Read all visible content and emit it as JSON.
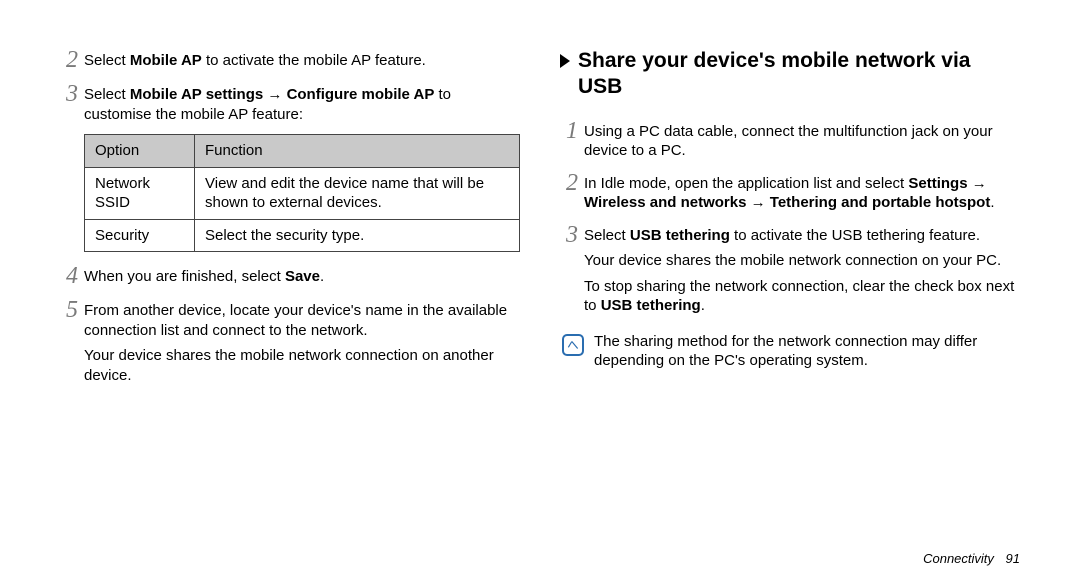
{
  "left": {
    "step2": {
      "num": "2",
      "before": "Select ",
      "b1": "Mobile AP",
      "after": " to activate the mobile AP feature."
    },
    "step3": {
      "num": "3",
      "before": "Select ",
      "b1": "Mobile AP settings",
      "arrow": " → ",
      "b2": "Configure mobile AP",
      "after": " to customise the mobile AP feature:"
    },
    "table": {
      "h1": "Option",
      "h2": "Function",
      "r1c1": "Network SSID",
      "r1c2": "View and edit the device name that will be shown to external devices.",
      "r2c1": "Security",
      "r2c2": "Select the security type."
    },
    "step4": {
      "num": "4",
      "before": "When you are finished, select ",
      "b1": "Save",
      "after": "."
    },
    "step5": {
      "num": "5",
      "p1": "From another device, locate your device's name in the available connection list and connect to the network.",
      "p2": "Your device shares the mobile network connection on another device."
    }
  },
  "right": {
    "title": "Share your device's mobile network via USB",
    "step1": {
      "num": "1",
      "text": "Using a PC data cable, connect the multifunction jack on your device to a PC."
    },
    "step2": {
      "num": "2",
      "before": "In Idle mode, open the application list and select ",
      "b1": "Settings",
      "arrow1": " → ",
      "b2": "Wireless and networks",
      "arrow2": " → ",
      "b3": "Tethering and portable hotspot",
      "after": "."
    },
    "step3": {
      "num": "3",
      "p1_before": "Select ",
      "p1_b": "USB tethering",
      "p1_after": " to activate the USB tethering feature.",
      "p2": "Your device shares the mobile network connection on your PC.",
      "p3_before": "To stop sharing the network connection, clear the check box next to ",
      "p3_b": "USB tethering",
      "p3_after": "."
    },
    "note": "The sharing method for the network connection may differ depending on the PC's operating system."
  },
  "footer": {
    "section": "Connectivity",
    "page": "91"
  }
}
